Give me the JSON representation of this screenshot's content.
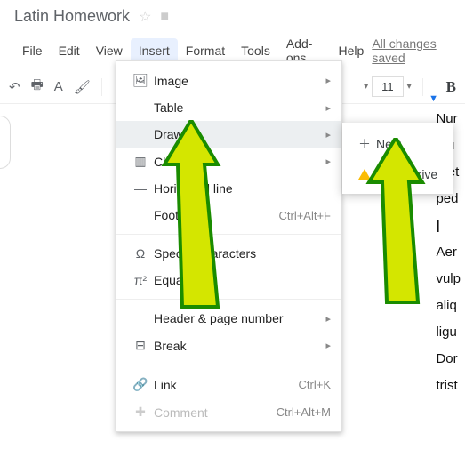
{
  "doc": {
    "title": "Latin Homework",
    "changes": "All changes saved"
  },
  "menubar": [
    "File",
    "Edit",
    "View",
    "Insert",
    "Format",
    "Tools",
    "Add-ons",
    "Help"
  ],
  "toolbar": {
    "fontsize": "11"
  },
  "insert_menu": {
    "image": "Image",
    "table": "Table",
    "drawing": "Drawing",
    "chart": "Chart",
    "hline": "Horizontal line",
    "footnote": "Footnote",
    "footnote_sc": "Ctrl+Alt+F",
    "special": "Special characters",
    "equation": "Equation",
    "header": "Header & page number",
    "break": "Break",
    "link": "Link",
    "link_sc": "Ctrl+K",
    "comment": "Comment",
    "comment_sc": "Ctrl+Alt+M"
  },
  "submenu": {
    "new": "New",
    "drive": "From Drive"
  },
  "doc_text": [
    "Nur",
    "etu",
    "pret",
    "ped",
    "|",
    "Aer",
    "vulp",
    "aliq",
    "ligu",
    "Dor",
    "trist"
  ]
}
